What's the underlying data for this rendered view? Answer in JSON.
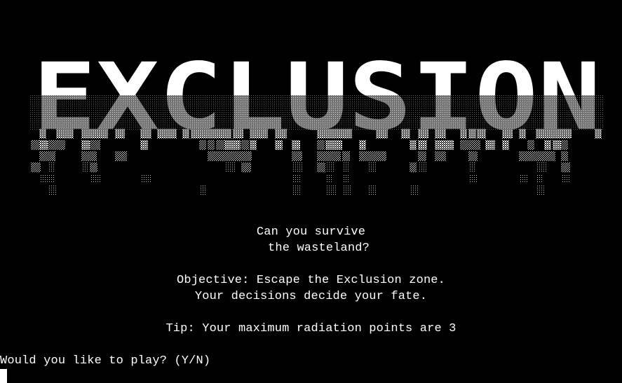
{
  "terminal": {
    "logo": {
      "text": "EXCLUSION",
      "colors": {
        "solid": "#ffffff",
        "dense": "#cfcfcf",
        "medium": "#9a9a9a",
        "sparse": "#6a6a6a",
        "background": "#000000"
      }
    },
    "lines": {
      "survive": "Can you survive",
      "wasteland": "the wasteland?",
      "objective": "Objective: Escape the Exclusion zone.",
      "decisions": "Your decisions decide your fate.",
      "tip": "Tip: Your maximum radiation points are 3",
      "prompt": "Would you like to play? (Y/N)"
    }
  }
}
